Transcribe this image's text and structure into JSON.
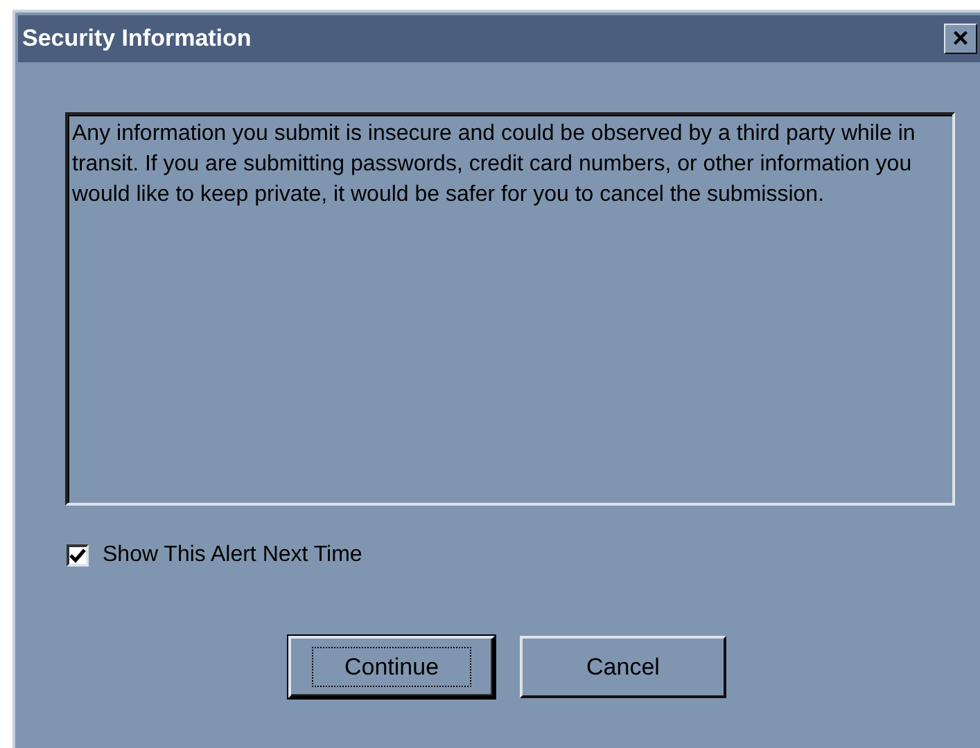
{
  "window": {
    "title": "Security Information",
    "close": "×"
  },
  "message": "Any information you submit is insecure and could be observed by a third party while in transit. If you are submitting passwords, credit card numbers, or other information you would like to keep private, it would be safer for you to cancel the submission.",
  "checkbox": {
    "label": "Show This Alert Next Time",
    "checked": true
  },
  "buttons": [
    {
      "label": "Continue",
      "selected": true
    },
    {
      "label": "Cancel",
      "selected": false
    }
  ]
}
